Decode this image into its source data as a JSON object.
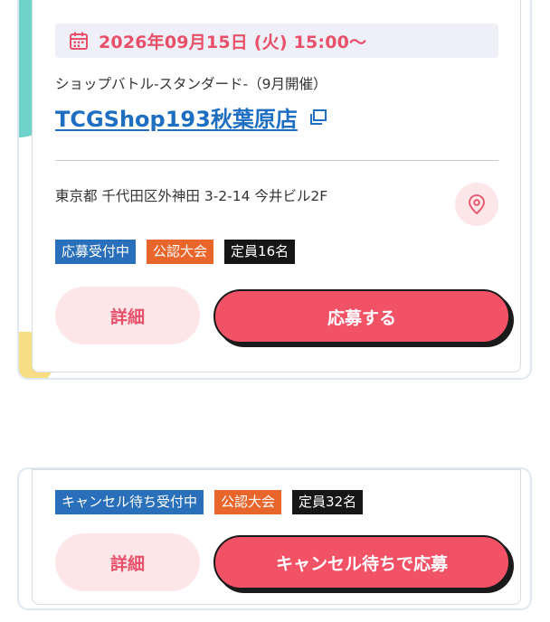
{
  "card1": {
    "date": "2026年09月15日 (火) 15:00〜",
    "event_title": "ショップバトル-スタンダード-（9月開催）",
    "shop_name": "TCGShop193秋葉原店",
    "address": "東京都 千代田区外神田 3-2-14 今井ビル2F",
    "badges": {
      "status": "応募受付中",
      "type": "公認大会",
      "capacity": "定員16名"
    },
    "detail_button": "詳細",
    "apply_button": "応募する"
  },
  "card2": {
    "badges": {
      "status": "キャンセル待ち受付中",
      "type": "公認大会",
      "capacity": "定員32名"
    },
    "detail_button": "詳細",
    "apply_button": "キャンセル待ちで応募"
  },
  "colors": {
    "accent": "#f25266",
    "date_text": "#e8506a",
    "link": "#1e6fc2",
    "badge_status": "#2a6fb9",
    "badge_type": "#e8662c",
    "badge_capacity": "#161616"
  },
  "icons": {
    "date": "calendar-icon",
    "shop_link": "external-link-icon",
    "address": "map-pin-icon"
  }
}
